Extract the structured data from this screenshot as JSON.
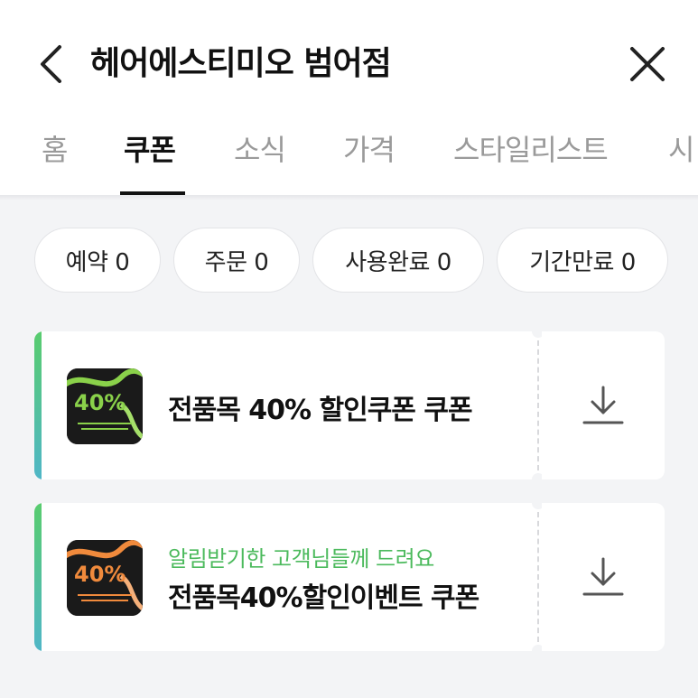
{
  "header": {
    "title": "헤어에스티미오 범어점",
    "back_icon": "chevron-left-icon",
    "close_icon": "close-icon"
  },
  "tabs": [
    {
      "label": "홈",
      "active": false
    },
    {
      "label": "쿠폰",
      "active": true
    },
    {
      "label": "소식",
      "active": false
    },
    {
      "label": "가격",
      "active": false
    },
    {
      "label": "스타일리스트",
      "active": false
    },
    {
      "label": "시",
      "active": false
    }
  ],
  "filters": [
    {
      "label": "예약 0"
    },
    {
      "label": "주문 0"
    },
    {
      "label": "사용완료 0"
    },
    {
      "label": "기간만료 0"
    }
  ],
  "coupons": [
    {
      "subtitle": "",
      "name": "전품목 40% 할인쿠폰 쿠폰",
      "thumb_text": "40%",
      "thumb_accent": "#8ad14a",
      "download_icon": "download-icon"
    },
    {
      "subtitle": "알림받기한 고객님들께 드려요",
      "name": "전품목40%할인이벤트 쿠폰",
      "thumb_text": "40%",
      "thumb_accent": "#f08a3c",
      "download_icon": "download-icon"
    }
  ],
  "colors": {
    "accent_green": "#4cba5d",
    "accent_gradient_end": "#4fb6c7",
    "background": "#f3f4f6"
  }
}
